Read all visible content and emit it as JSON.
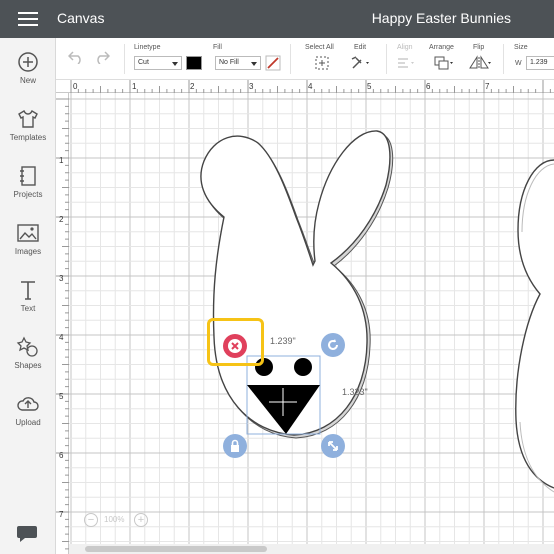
{
  "app": {
    "title": "Canvas",
    "project_name": "Happy Easter Bunnies"
  },
  "sidebar": {
    "items": [
      {
        "label": "New",
        "icon": "plus-circle-icon"
      },
      {
        "label": "Templates",
        "icon": "shirt-icon"
      },
      {
        "label": "Projects",
        "icon": "notebook-icon"
      },
      {
        "label": "Images",
        "icon": "image-icon"
      },
      {
        "label": "Text",
        "icon": "text-t-icon"
      },
      {
        "label": "Shapes",
        "icon": "shapes-icon"
      },
      {
        "label": "Upload",
        "icon": "cloud-upload-icon"
      }
    ],
    "chat_icon": "chat-bubble-icon"
  },
  "toolbar": {
    "linetype": {
      "label": "Linetype",
      "value": "Cut"
    },
    "fill": {
      "label": "Fill",
      "value": "No Fill",
      "swatch_color": "#000000"
    },
    "select_all": {
      "label": "Select All"
    },
    "edit": {
      "label": "Edit"
    },
    "align": {
      "label": "Align"
    },
    "arrange": {
      "label": "Arrange"
    },
    "flip": {
      "label": "Flip"
    },
    "size": {
      "label": "Size",
      "w_label": "W",
      "w_value": "1.239"
    }
  },
  "ruler": {
    "top": [
      "0",
      "1",
      "2",
      "3",
      "4",
      "5",
      "6",
      "7"
    ],
    "left": [
      "1",
      "2",
      "3",
      "4",
      "5",
      "6",
      "7"
    ]
  },
  "selection": {
    "width_label": "1.239\"",
    "height_label": "1.323\""
  },
  "zoom": {
    "value": "100%",
    "minus": "−",
    "plus": "+"
  },
  "colors": {
    "accent_delete": "#e0405c",
    "handle_blue": "#8fb0dd",
    "highlight": "#f6c316",
    "topbar": "#4d5256"
  }
}
